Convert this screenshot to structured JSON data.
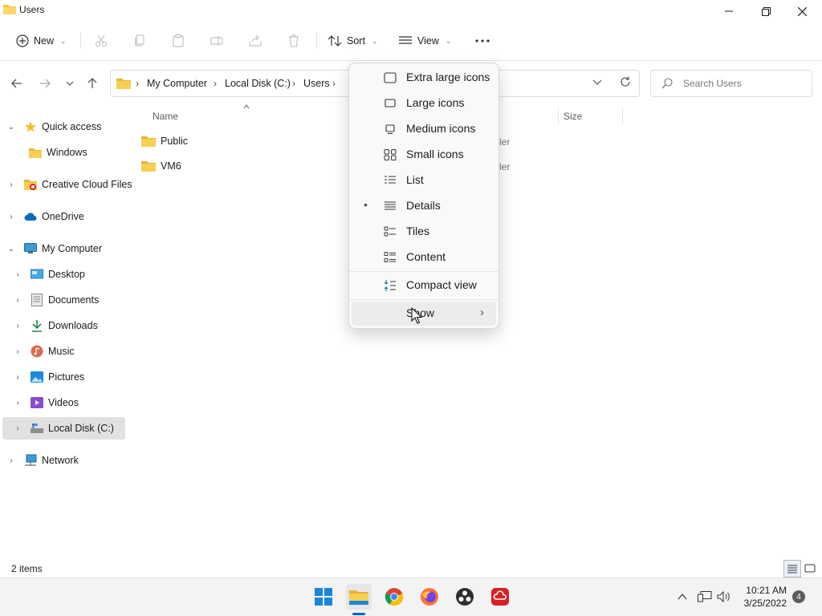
{
  "window": {
    "title": "Users",
    "controls": [
      "minimize",
      "restore",
      "close"
    ]
  },
  "toolbar": {
    "new_label": "New",
    "sort_label": "Sort",
    "view_label": "View",
    "more_icon": "ellipsis-icon",
    "disabled_actions": [
      "cut",
      "copy",
      "paste",
      "rename",
      "share",
      "delete"
    ]
  },
  "address": {
    "breadcrumbs": [
      "My Computer",
      "Local Disk (C:)",
      "Users"
    ],
    "separator": "›"
  },
  "search": {
    "placeholder": "Search Users"
  },
  "sidebar": {
    "items": [
      {
        "label": "Quick access",
        "icon": "star-icon",
        "expanded": true
      },
      {
        "label": "Windows",
        "icon": "folder-icon"
      },
      {
        "label": "Creative Cloud Files",
        "icon": "creative-cloud-folder-icon"
      },
      {
        "label": "OneDrive",
        "icon": "cloud-icon"
      },
      {
        "label": "My Computer",
        "icon": "computer-icon",
        "expanded": true
      },
      {
        "label": "Desktop",
        "icon": "desktop-icon"
      },
      {
        "label": "Documents",
        "icon": "documents-icon"
      },
      {
        "label": "Downloads",
        "icon": "download-icon"
      },
      {
        "label": "Music",
        "icon": "music-icon"
      },
      {
        "label": "Pictures",
        "icon": "pictures-icon"
      },
      {
        "label": "Videos",
        "icon": "videos-icon"
      },
      {
        "label": "Local Disk (C:)",
        "icon": "drive-icon",
        "selected": true
      },
      {
        "label": "Network",
        "icon": "network-icon"
      }
    ]
  },
  "files": {
    "columns": {
      "name": "Name",
      "size": "Size"
    },
    "rows": [
      {
        "name": "Public",
        "type_partial": "ler"
      },
      {
        "name": "VM6",
        "type_partial": "ler"
      }
    ]
  },
  "view_menu": {
    "items": [
      {
        "label": "Extra large icons",
        "icon": "extra-large-icons-icon"
      },
      {
        "label": "Large icons",
        "icon": "large-icons-icon"
      },
      {
        "label": "Medium icons",
        "icon": "medium-icons-icon"
      },
      {
        "label": "Small icons",
        "icon": "small-icons-icon"
      },
      {
        "label": "List",
        "icon": "list-icon"
      },
      {
        "label": "Details",
        "icon": "details-icon",
        "selected": true
      },
      {
        "label": "Tiles",
        "icon": "tiles-icon"
      },
      {
        "label": "Content",
        "icon": "content-icon"
      },
      {
        "label": "Compact view",
        "icon": "compact-view-icon"
      },
      {
        "label": "Show",
        "submenu": true,
        "hovered": true
      }
    ],
    "selected_bullet": "•",
    "submenu_arrow": "›"
  },
  "status": {
    "item_count": "2 items"
  },
  "taskbar": {
    "apps": [
      "windows-start-icon",
      "file-explorer-icon",
      "chrome-icon",
      "firefox-icon",
      "obs-icon",
      "creative-cloud-icon"
    ],
    "time": "10:21 AM",
    "date": "3/25/2022",
    "notifications": "4"
  },
  "colors": {
    "accent": "#0067c0",
    "folder": "#f3c244",
    "menu_bg": "#f9f9f9"
  }
}
